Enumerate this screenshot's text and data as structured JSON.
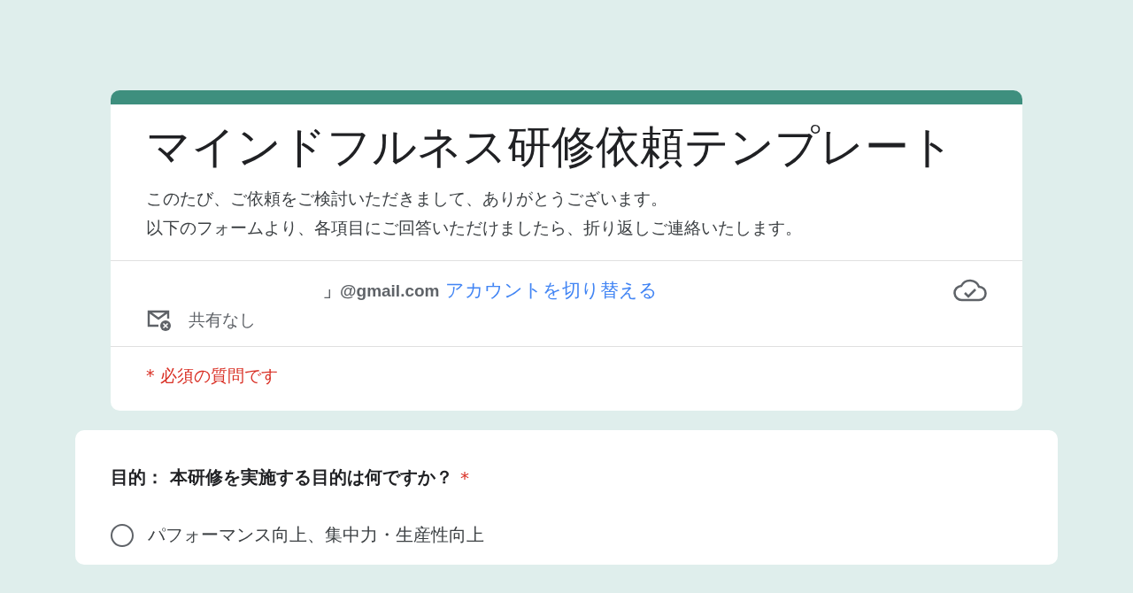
{
  "header": {
    "title": "マインドフルネス研修依頼テンプレート",
    "description": [
      "このたび、ご依頼をご検討いただきまして、ありがとうございます。",
      "以下のフォームより、各項目にご回答いただけましたら、折り返しご連絡いたします。"
    ],
    "account": {
      "email": "」@gmail.com",
      "switch_link": "アカウントを切り替える",
      "sharing": "共有なし"
    },
    "required_note": "* 必須の質問です"
  },
  "question": {
    "title": "目的： 本研修を実施する目的は何ですか？",
    "required_mark": "*",
    "options": [
      {
        "label": "パフォーマンス向上、集中力・生産性向上",
        "selected": false
      }
    ]
  }
}
